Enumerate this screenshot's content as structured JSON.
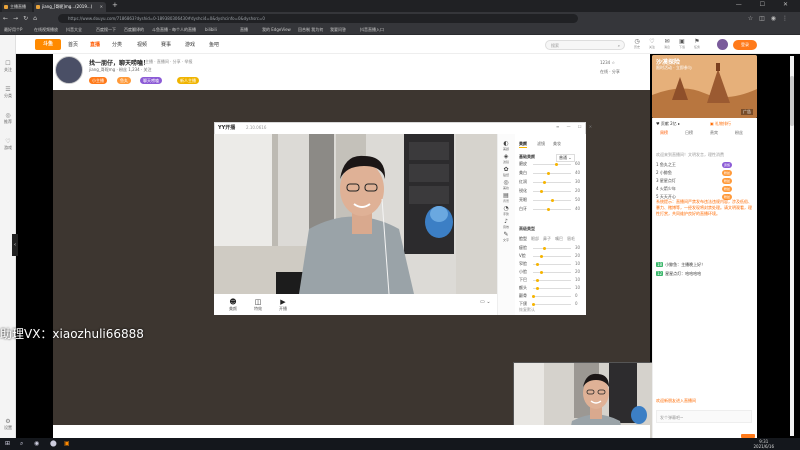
{
  "browser": {
    "tabs": [
      {
        "label": "主播直播"
      },
      {
        "label": "jiang_[哥呢]mg...(2019...)"
      }
    ],
    "url": "https://www.douyu.com/7186863?dyshid=0-189380306430#dyshci4=0&dyshcinfo=0&dyshsrc=0"
  },
  "bookmarks": [
    "最好用个P",
    "在线视频播放",
    "抖音大全",
    "百度搜一下",
    "百度翻译的",
    "斗鱼直播 - 每个人的直播",
    "bilibili",
    "直播",
    "我的 EdgeView",
    "回合制 我为何",
    "我要问答",
    "抖音直播入口"
  ],
  "rail": [
    {
      "icon": "☐",
      "label": "关注"
    },
    {
      "icon": "☰",
      "label": "分类"
    },
    {
      "icon": "◎",
      "label": "推荐"
    },
    {
      "icon": "♡",
      "label": "游戏"
    },
    {
      "icon": "⚙",
      "label": "设置"
    }
  ],
  "site": {
    "logo": "斗鱼",
    "nav": [
      {
        "label": "首页"
      },
      {
        "label": "直播"
      },
      {
        "label": "分类"
      },
      {
        "label": "视频"
      },
      {
        "label": "赛事"
      },
      {
        "label": "游戏"
      },
      {
        "label": "鱼吧"
      }
    ],
    "search_placeholder": "搜索",
    "header_icons": [
      {
        "icon": "◷",
        "label": "历史"
      },
      {
        "icon": "♡",
        "label": "关注"
      },
      {
        "icon": "✉",
        "label": "消息"
      },
      {
        "icon": "▣",
        "label": "下载"
      },
      {
        "icon": "⚑",
        "label": "任务"
      }
    ],
    "login": "登录"
  },
  "room": {
    "title": "找一朋仔，聊天唠嗑！",
    "meta": "主播 · 直播间 · 分享 · 举报",
    "anchor": "jiang_哥呢mg · 粉丝 1,234 · 关注",
    "chips": [
      {
        "label": "小主播",
        "color": "#ff7a1a"
      },
      {
        "label": "鱼丸",
        "color": "#ff9a3a"
      },
      {
        "label": "聊天唠嗑",
        "color": "#8c5bd6"
      },
      {
        "label": "新人主播",
        "color": "#f0b400"
      }
    ],
    "right_stats": [
      "1234 ☆",
      "在线 · 分享"
    ]
  },
  "recorder": {
    "title": "YY开播",
    "version": "2.10.0616",
    "controls": "≡ — ☐ ✕",
    "bottom_buttons": [
      {
        "icon": "☻",
        "label": "美颜"
      },
      {
        "icon": "◫",
        "label": "特效"
      },
      {
        "icon": "▶",
        "label": "开播"
      }
    ],
    "rate": "▭ ⌄",
    "side_icons": [
      {
        "icon": "◐",
        "label": "美颜"
      },
      {
        "icon": "◈",
        "label": "滤镜"
      },
      {
        "icon": "✿",
        "label": "贴纸"
      },
      {
        "icon": "◎",
        "label": "美妆"
      },
      {
        "icon": "▤",
        "label": "背景"
      },
      {
        "icon": "◔",
        "label": "手势"
      },
      {
        "icon": "♪",
        "label": "音效"
      },
      {
        "icon": "✎",
        "label": "文字"
      }
    ],
    "panel_tabs": [
      {
        "label": "美颜"
      },
      {
        "label": "滤镜"
      },
      {
        "label": "美妆"
      }
    ],
    "section1": "基础美颜",
    "preset": "普通 ⌄",
    "sliders1": [
      {
        "label": "磨皮",
        "value": "60",
        "pct": 0.6
      },
      {
        "label": "美白",
        "value": "40",
        "pct": 0.4
      },
      {
        "label": "红润",
        "value": "30",
        "pct": 0.3
      },
      {
        "label": "锐化",
        "value": "20",
        "pct": 0.2
      },
      {
        "label": "亮眼",
        "value": "50",
        "pct": 0.5
      },
      {
        "label": "白牙",
        "value": "40",
        "pct": 0.4
      }
    ],
    "section2": "高级美型",
    "panel2_tabs": [
      "脸型",
      "眼部",
      "鼻子",
      "嘴巴",
      "眉毛"
    ],
    "sliders2": [
      {
        "label": "瘦脸",
        "value": "30",
        "pct": 0.3
      },
      {
        "label": "V脸",
        "value": "20",
        "pct": 0.2
      },
      {
        "label": "窄脸",
        "value": "10",
        "pct": 0.1
      },
      {
        "label": "小脸",
        "value": "20",
        "pct": 0.2
      },
      {
        "label": "下巴",
        "value": "10",
        "pct": 0.1
      },
      {
        "label": "额头",
        "value": "10",
        "pct": 0.1
      },
      {
        "label": "颧骨",
        "value": "0",
        "pct": 0.0
      },
      {
        "label": "下颌",
        "value": "0",
        "pct": 0.0
      }
    ],
    "panel_footer": "恢复默认"
  },
  "overlay_text": "助理VX：xiaozhuli66888",
  "sidebar": {
    "ad_line1": "沙漠探险",
    "ad_line2": "限时活动 · 立即参与",
    "ad_line3": "广告",
    "row1": "♥ 贡献 2亿 ▸",
    "row1b": "▣ 礼物排行",
    "tabs": [
      {
        "label": "周榜"
      },
      {
        "label": "日榜"
      },
      {
        "label": "贵宾"
      },
      {
        "label": "粉丝"
      }
    ],
    "notice": "欢迎来到直播间！文明发言，理性消费",
    "ranks": [
      {
        "name": "1 鱼丸之王",
        "badge": "贵族"
      },
      {
        "name": "2 小鲸鱼",
        "badge": "粉丝"
      },
      {
        "name": "3 星星点灯",
        "badge": "粉丝"
      },
      {
        "name": "4 火箭少年",
        "badge": "粉丝"
      },
      {
        "name": "5 天天开心",
        "badge": "粉丝"
      }
    ],
    "chat_system": "系统提示：直播间严禁发布违法违规内容，涉及低俗、暴力、赌博等，一经发现将封禁处理。请文明观看，理性打赏，共同维护良好的直播环境。",
    "messages": [
      {
        "level": "18",
        "text": "小鲸鱼：主播晚上好！"
      },
      {
        "level": "12",
        "text": "星星点灯：哈哈哈哈"
      }
    ],
    "bottom_tip": "欢迎新朋友进入直播间",
    "chat_placeholder": "发个弹幕吧~"
  },
  "taskbar": {
    "icons": [
      "⊞",
      "⌕",
      "◉",
      "⬤",
      "▣"
    ],
    "time": "9:31",
    "date": "2021/6/16"
  }
}
